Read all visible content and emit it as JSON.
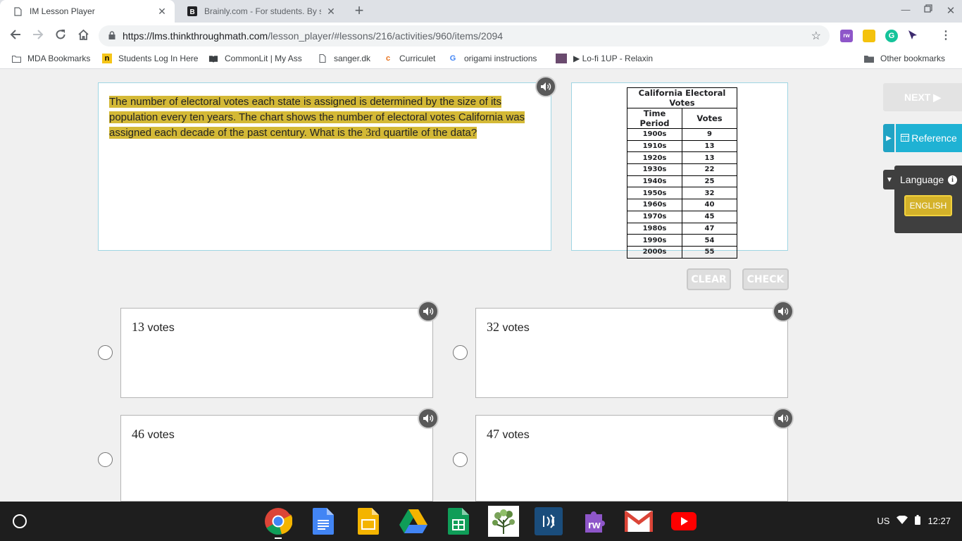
{
  "browser": {
    "tabs": [
      {
        "title": "IM Lesson Player",
        "active": true
      },
      {
        "title": "Brainly.com - For students. By st",
        "active": false
      }
    ],
    "url": {
      "host": "https://lms.thinkthroughmath.com",
      "path": "/lesson_player/#lessons/216/activities/960/items/2094"
    },
    "bookmarks": [
      {
        "label": "MDA Bookmarks",
        "icon": "folder-icon"
      },
      {
        "label": "Students Log In Here",
        "icon": "site-icon"
      },
      {
        "label": "CommonLit | My Ass",
        "icon": "book-icon"
      },
      {
        "label": "sanger.dk",
        "icon": "page-icon"
      },
      {
        "label": "Curriculet",
        "icon": "curriculet-icon"
      },
      {
        "label": "origami instructions",
        "icon": "google-icon"
      },
      {
        "label": "▶ Lo-fi 1UP - Relaxin",
        "icon": "video-icon"
      }
    ],
    "other_bookmarks": "Other bookmarks"
  },
  "question": {
    "text_before": "The number of electoral votes each state is assigned is determined by the size of its population every ten years. The chart shows the number of electoral votes California was assigned each decade of the past century. What is the ",
    "math": "3rd",
    "text_after": " quartile of the data?"
  },
  "table": {
    "caption": "California Electoral Votes",
    "headers": [
      "Time Period",
      "Votes"
    ],
    "rows": [
      [
        "1900s",
        "9"
      ],
      [
        "1910s",
        "13"
      ],
      [
        "1920s",
        "13"
      ],
      [
        "1930s",
        "22"
      ],
      [
        "1940s",
        "25"
      ],
      [
        "1950s",
        "32"
      ],
      [
        "1960s",
        "40"
      ],
      [
        "1970s",
        "45"
      ],
      [
        "1980s",
        "47"
      ],
      [
        "1990s",
        "54"
      ],
      [
        "2000s",
        "55"
      ]
    ]
  },
  "side": {
    "next": "NEXT ▶",
    "reference": "Reference",
    "language": "Language",
    "language_value": "ENGLISH"
  },
  "actions": {
    "clear": "CLEAR",
    "check": "CHECK"
  },
  "answers": [
    {
      "num": "13",
      "unit": " votes"
    },
    {
      "num": "32",
      "unit": " votes"
    },
    {
      "num": "46",
      "unit": " votes"
    },
    {
      "num": "47",
      "unit": " votes"
    }
  ],
  "tray": {
    "locale": "US",
    "time": "12:27"
  },
  "colors": {
    "highlight": "#d4b936",
    "accent": "#1fb2d4",
    "box_border": "#9fd5e3"
  }
}
